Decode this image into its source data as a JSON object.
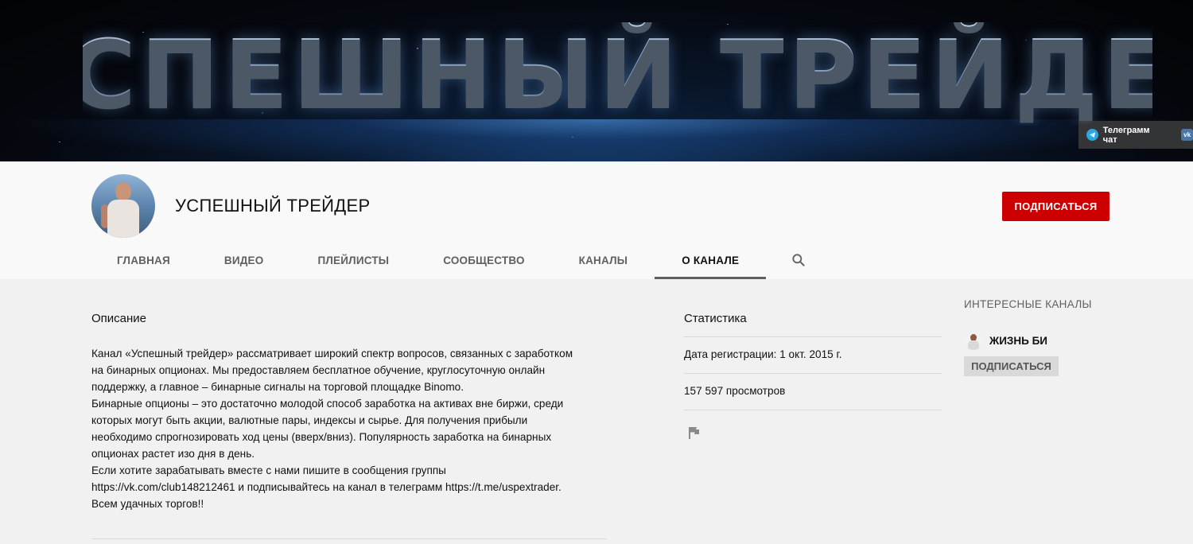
{
  "banner": {
    "title": "УСПЕШНЫЙ ТРЕЙДЕР",
    "links": [
      {
        "label": "Телеграмм чат",
        "icon": "telegram-icon"
      },
      {
        "label": "",
        "icon": "vk-icon"
      }
    ]
  },
  "channel": {
    "name": "УСПЕШНЫЙ ТРЕЙДЕР",
    "subscribe_label": "ПОДПИСАТЬСЯ"
  },
  "tabs": [
    {
      "label": "ГЛАВНАЯ",
      "active": false
    },
    {
      "label": "ВИДЕО",
      "active": false
    },
    {
      "label": "ПЛЕЙЛИСТЫ",
      "active": false
    },
    {
      "label": "СООБЩЕСТВО",
      "active": false
    },
    {
      "label": "КАНАЛЫ",
      "active": false
    },
    {
      "label": "О КАНАЛЕ",
      "active": true
    }
  ],
  "description": {
    "title": "Описание",
    "text": "Канал «Успешный трейдер» рассматривает широкий спектр вопросов, связанных с заработком\nна бинарных опционах. Мы предоставляем бесплатное обучение, круглосуточную онлайн\nподдержку, а главное – бинарные сигналы на торговой площадке Binomo.\nБинарные опционы – это достаточно молодой способ заработка на активах вне биржи, среди\nкоторых могут быть акции, валютные пары, индексы и сырье. Для получения прибыли\nнеобходимо спрогнозировать ход цены (вверх/вниз). Популярность заработка на бинарных\nопционах растет изо дня в день.\nЕсли хотите зарабатывать вместе с нами пишите в сообщения группы\nhttps://vk.com/club148212461 и подписывайтесь на канал в телеграмм https://t.me/uspextrader.\nВсем удачных торгов!!"
  },
  "stats": {
    "title": "Статистика",
    "registration": "Дата регистрации: 1 окт. 2015 г.",
    "views": "157 597 просмотров"
  },
  "featured": {
    "title": "ИНТЕРЕСНЫЕ КАНАЛЫ",
    "channel_name": "ЖИЗНЬ БИ",
    "subscribe_label": "ПОДПИСАТЬСЯ"
  },
  "colors": {
    "subscribe": "#cc0000",
    "active_tab_underline": "#606060",
    "page_background": "#f1f1f1"
  }
}
